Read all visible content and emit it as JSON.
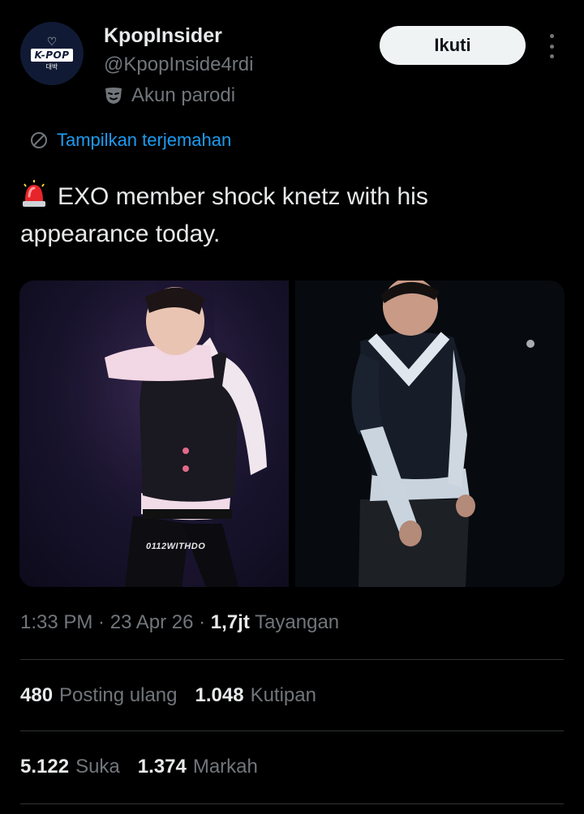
{
  "author": {
    "name": "KpopInsider",
    "handle": "@KpopInside4rdi",
    "parody_label": "Akun parodi",
    "avatar_text": "K-POP",
    "avatar_subtext": "대박"
  },
  "actions": {
    "follow_label": "Ikuti",
    "translate_label": "Tampilkan terjemahan"
  },
  "tweet": {
    "text": "EXO member shock knetz with his appearance today.",
    "siren_icon": "police-light-icon"
  },
  "media": {
    "watermark": "0112WITHDO"
  },
  "meta": {
    "time": "1:33 PM",
    "sep1": " · ",
    "date": "23 Apr 26",
    "sep2": " · ",
    "views_value": "1,7jt",
    "views_label": " Tayangan"
  },
  "stats": {
    "reposts_value": "480",
    "reposts_label": "Posting ulang",
    "quotes_value": "1.048",
    "quotes_label": "Kutipan",
    "likes_value": "5.122",
    "likes_label": "Suka",
    "bookmarks_value": "1.374",
    "bookmarks_label": "Markah"
  },
  "colors": {
    "accent": "#1d9bf0",
    "text": "#e7e9ea",
    "muted": "#71767b",
    "divider": "#2f3336"
  }
}
